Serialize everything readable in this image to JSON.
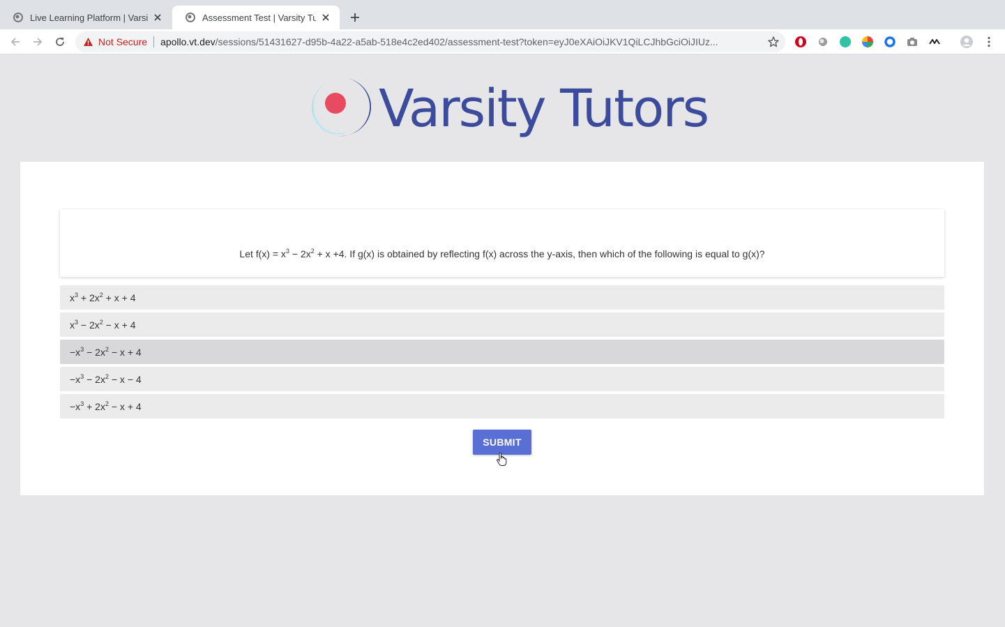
{
  "browser": {
    "tabs": [
      {
        "title": "Live Learning Platform | Varsity Tutors",
        "active": false
      },
      {
        "title": "Assessment Test | Varsity Tutors",
        "active": true
      }
    ],
    "security_label": "Not Secure",
    "url_host": "apollo.vt.dev",
    "url_path": "/sessions/51431627-d95b-4a22-a5ab-518e4c2ed402/assessment-test?token=eyJ0eXAiOiJKV1QiLCJhbGciOiJIUz...",
    "extension_icons": [
      "opera-icon",
      "circle-icon",
      "grammarly-icon",
      "color-wheel-icon",
      "ring-icon",
      "camera-icon",
      "signature-icon"
    ]
  },
  "logo": {
    "brand": "Varsity Tutors",
    "colors": {
      "text": "#3c4b9c",
      "dot": "#e84a5f",
      "ring": "#8fd3e8"
    }
  },
  "question": {
    "prefix": "Let f(x) = x",
    "exp1": "3",
    "mid1": " − 2x",
    "exp2": "2",
    "suffix": " + x +4. If g(x) is obtained by reflecting f(x) across the y-axis, then which of the following is equal to g(x)?"
  },
  "options": [
    {
      "a": "x",
      "e1": "3",
      "b": " + 2x",
      "e2": "2",
      "c": " + x + 4"
    },
    {
      "a": "x",
      "e1": "3",
      "b": " − 2x",
      "e2": "2",
      "c": " − x + 4"
    },
    {
      "a": "−x",
      "e1": "3",
      "b": " − 2x",
      "e2": "2",
      "c": " − x + 4"
    },
    {
      "a": "−x",
      "e1": "3",
      "b": " − 2x",
      "e2": "2",
      "c": " − x − 4"
    },
    {
      "a": "−x",
      "e1": "3",
      "b": " + 2x",
      "e2": "2",
      "c": " − x + 4"
    }
  ],
  "submit_label": "SUBMIT",
  "accent_color": "#5a6fd6"
}
